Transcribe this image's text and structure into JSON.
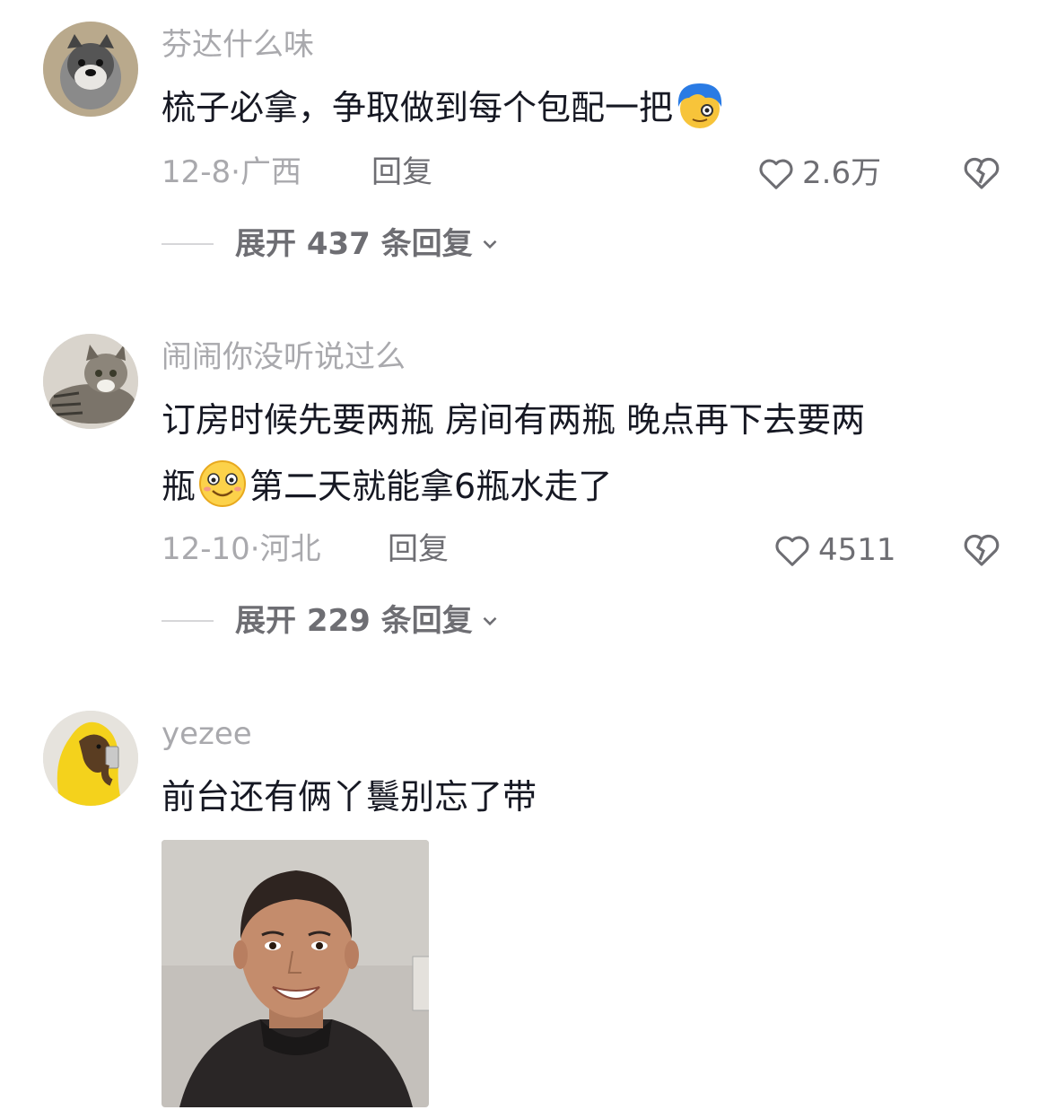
{
  "comments": [
    {
      "username": "芬达什么味",
      "text_before": "梳子必拿，争取做到每个包配一把",
      "text_after": "",
      "emoji": "blue-hair-face-emoji",
      "date_loc": "12-8·广西",
      "reply_label": "回复",
      "likes": "2.6万",
      "expand": "展开 437 条回复"
    },
    {
      "username": "闹闹你没听说过么",
      "text_line1": "订房时候先要两瓶 房间有两瓶 晚点再下去要两",
      "text_line2_before": "瓶",
      "emoji": "smiling-face-emoji",
      "text_line2_after": "第二天就能拿6瓶水走了",
      "date_loc": "12-10·河北",
      "reply_label": "回复",
      "likes": "4511",
      "expand": "展开 229 条回复"
    },
    {
      "username": "yezee",
      "text": "前台还有俩丫鬟别忘了带",
      "image": "man-smiling-photo"
    }
  ]
}
